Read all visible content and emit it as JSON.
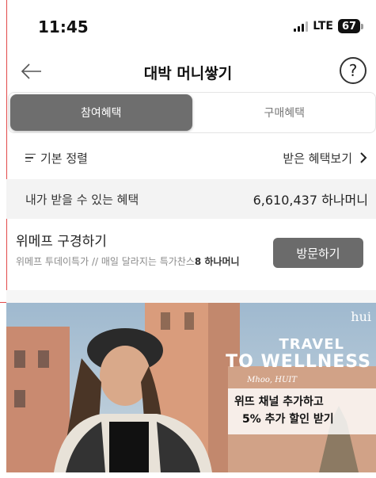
{
  "status_bar": {
    "time": "11:45",
    "network": "LTE",
    "battery": "67"
  },
  "header": {
    "title": "대박 머니쌓기",
    "help_label": "?"
  },
  "tabs": [
    {
      "label": "참여혜택",
      "active": true
    },
    {
      "label": "구매혜택",
      "active": false
    }
  ],
  "sort": {
    "label": "기본 정렬",
    "view_label": "받은 혜택보기"
  },
  "summary": {
    "label": "내가 받을 수 있는 혜택",
    "value": "6,610,437 하나머니"
  },
  "item": {
    "name": "위메프 구경하기",
    "desc_text": "위메프 투데이특가 // 매일 달라지는 특가찬스",
    "desc_reward": "8 하나머니",
    "button_label": "방문하기"
  },
  "banner": {
    "brand": "hui",
    "headline_line1": "TRAVEL",
    "headline_line2": "TO WELLNESS",
    "script": "Mhoo, HUIT",
    "cta_line1": "위뜨 채널 추가하고",
    "cta_line2": "5% 추가 할인 받기"
  },
  "colors": {
    "active_tab": "#6e6e6e",
    "button": "#6b6b6b",
    "summary_bg": "#f3f3f3"
  }
}
